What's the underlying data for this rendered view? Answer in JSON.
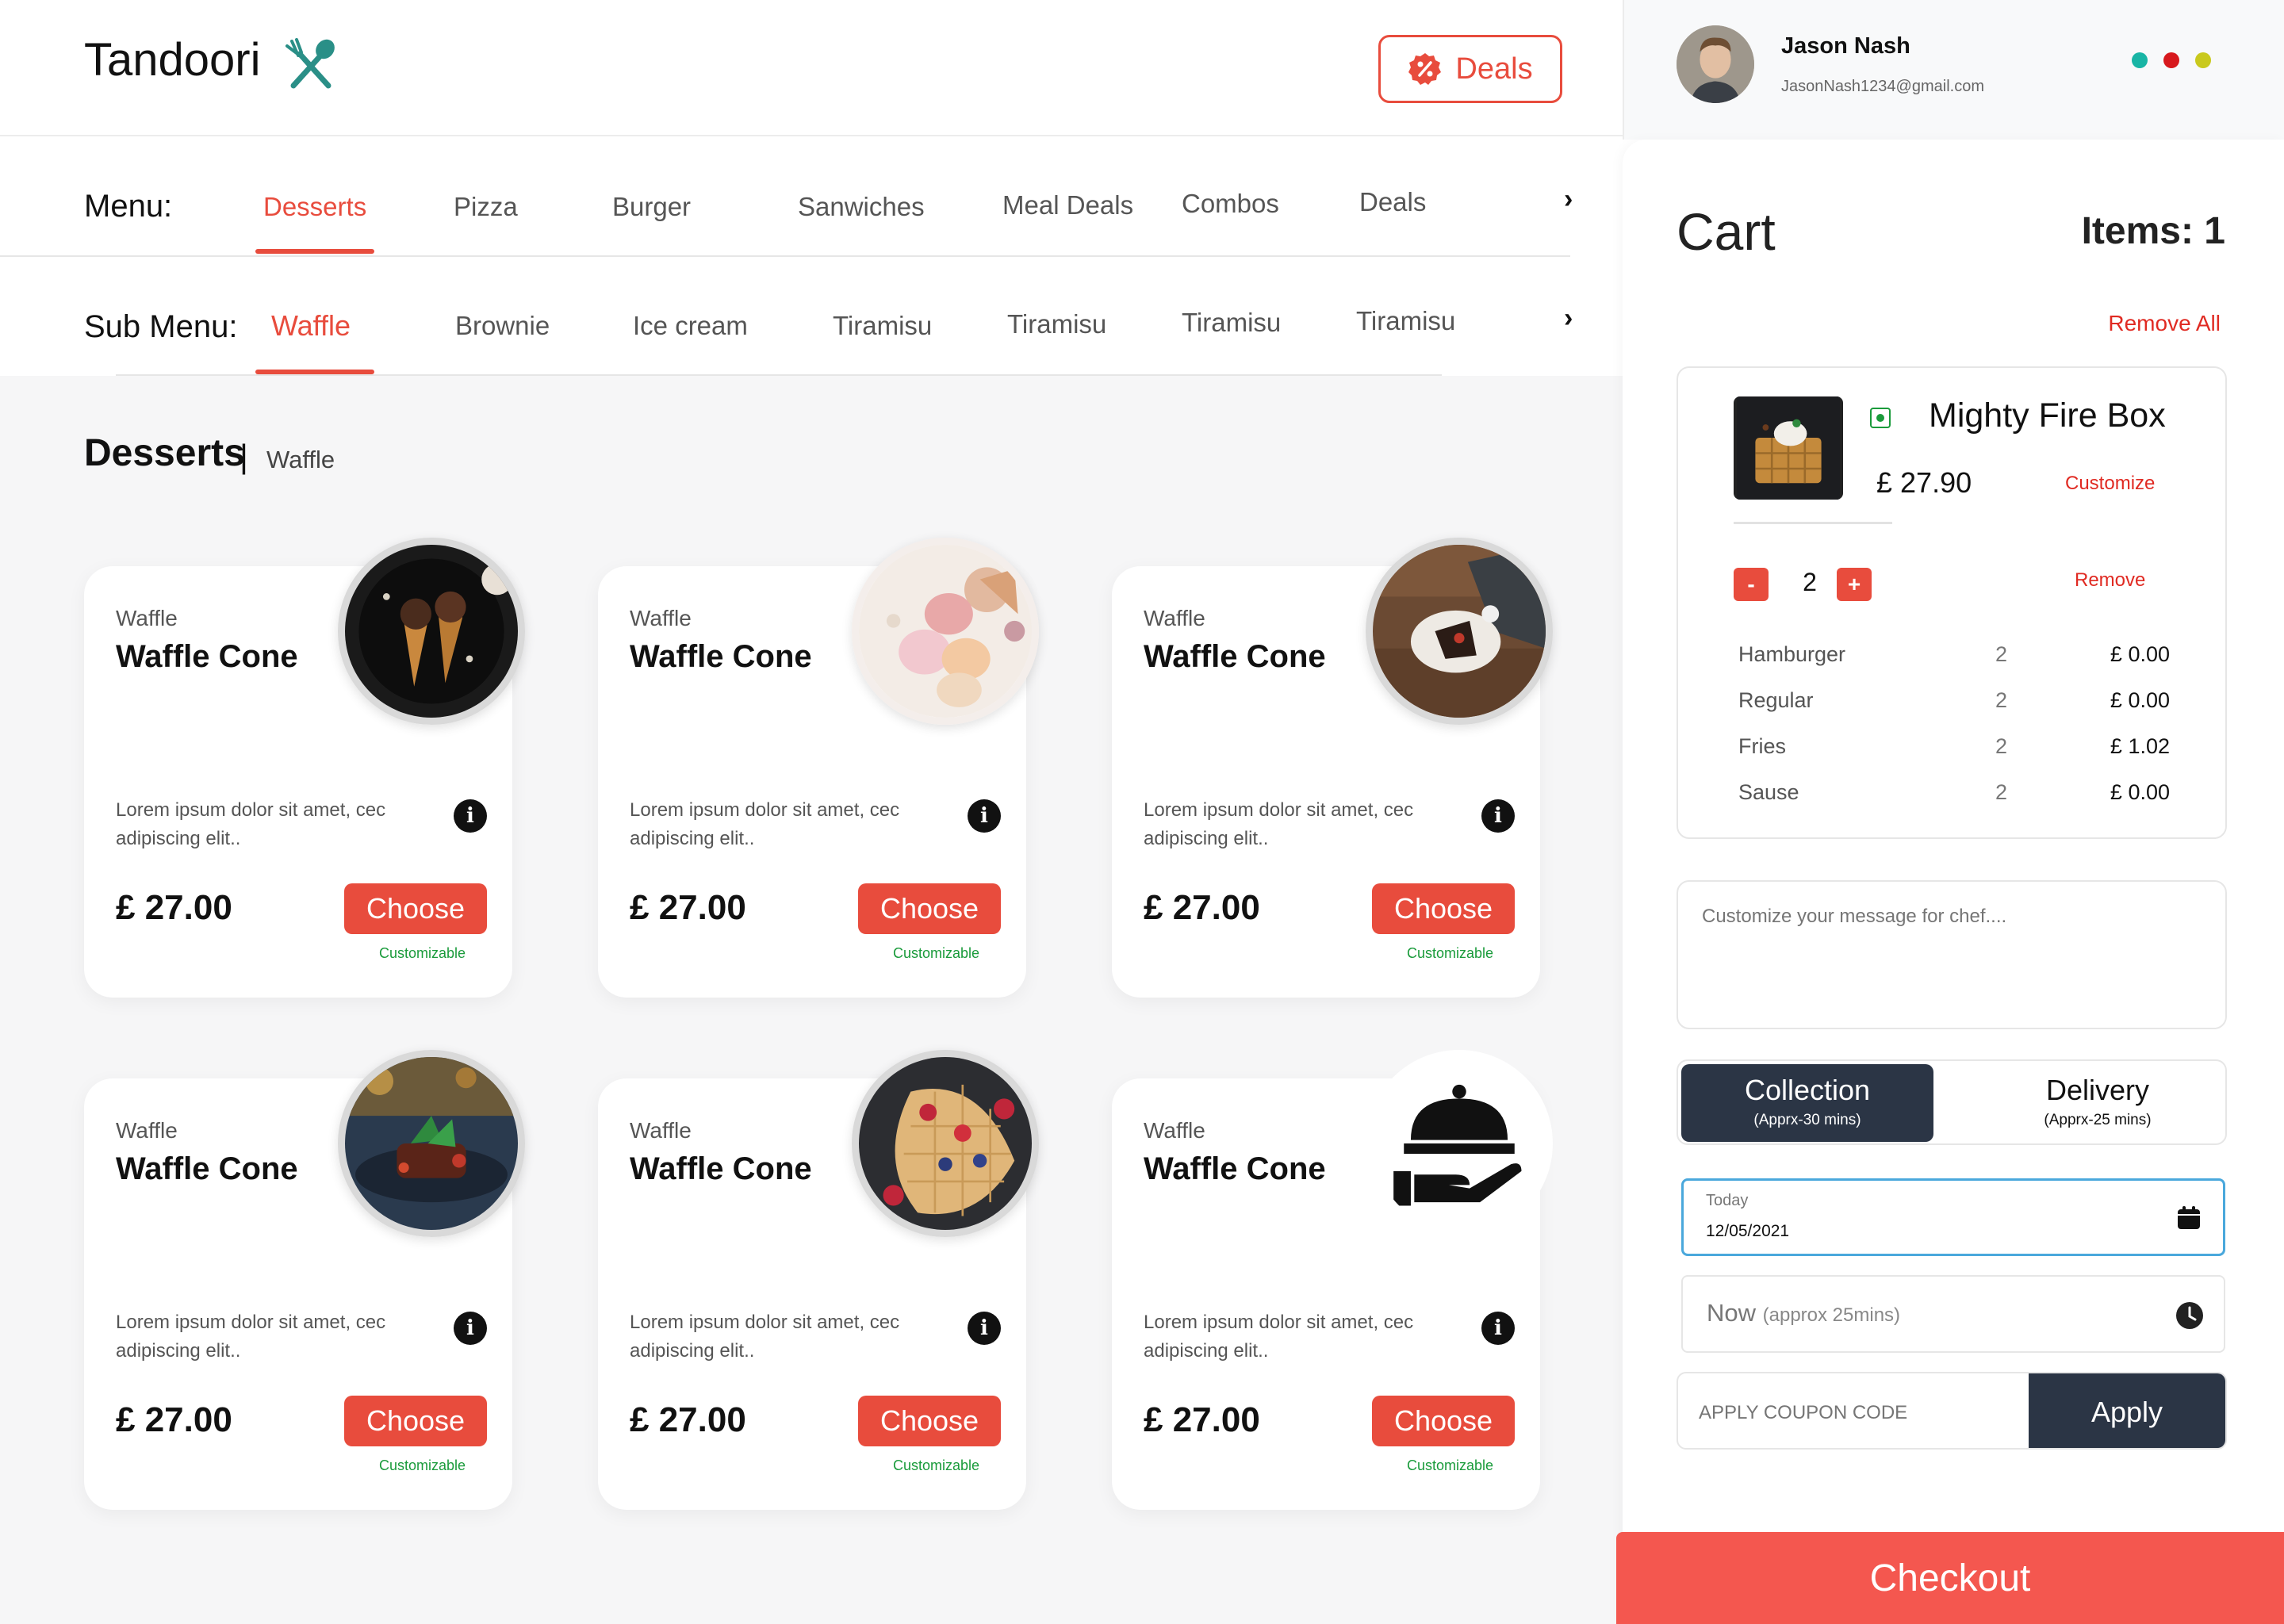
{
  "header": {
    "brand": "Tandoori",
    "deals_label": "Deals"
  },
  "menu": {
    "label": "Menu:",
    "items": [
      "Desserts",
      "Pizza",
      "Burger",
      "Sanwiches",
      "Meal Deals",
      "Combos",
      "Deals"
    ],
    "active": "Desserts"
  },
  "submenu": {
    "label": "Sub Menu:",
    "items": [
      "Waffle",
      "Brownie",
      "Ice cream",
      "Tiramisu",
      "Tiramisu",
      "Tiramisu",
      "Tiramisu"
    ],
    "active": "Waffle"
  },
  "section": {
    "title": "Desserts",
    "separator": "|",
    "subtitle": "Waffle"
  },
  "products": [
    {
      "category": "Waffle",
      "name": "Waffle Cone",
      "description": "Lorem ipsum dolor sit amet, cec adipiscing elit..",
      "price": "£ 27.00",
      "button": "Choose",
      "tag": "Customizable",
      "image": "ice-cream-cones-photo"
    },
    {
      "category": "Waffle",
      "name": "Waffle Cone",
      "description": "Lorem ipsum dolor sit amet, cec adipiscing elit..",
      "price": "£ 27.00",
      "button": "Choose",
      "tag": "Customizable",
      "image": "macarons-photo"
    },
    {
      "category": "Waffle",
      "name": "Waffle Cone",
      "description": "Lorem ipsum dolor sit amet, cec adipiscing elit..",
      "price": "£ 27.00",
      "button": "Choose",
      "tag": "Customizable",
      "image": "dessert-plate-photo"
    },
    {
      "category": "Waffle",
      "name": "Waffle Cone",
      "description": "Lorem ipsum dolor sit amet, cec adipiscing elit..",
      "price": "£ 27.00",
      "button": "Choose",
      "tag": "Customizable",
      "image": "steak-dish-photo"
    },
    {
      "category": "Waffle",
      "name": "Waffle Cone",
      "description": "Lorem ipsum dolor sit amet, cec adipiscing elit..",
      "price": "£ 27.00",
      "button": "Choose",
      "tag": "Customizable",
      "image": "berry-waffle-photo"
    },
    {
      "category": "Waffle",
      "name": "Waffle Cone",
      "description": "Lorem ipsum dolor sit amet, cec adipiscing elit..",
      "price": "£ 27.00",
      "button": "Choose",
      "tag": "Customizable",
      "image": "serving-cloche-icon"
    }
  ],
  "user": {
    "name": "Jason Nash",
    "email": "JasonNash1234@gmail.com",
    "dot_colors": [
      "#19b5a5",
      "#d7191d",
      "#c9c91d"
    ]
  },
  "cart": {
    "title": "Cart",
    "items_count": "Items: 1",
    "remove_all": "Remove All",
    "item": {
      "name": "Mighty Fire Box",
      "price": "£ 27.90",
      "customize": "Customize",
      "quantity": "2",
      "minus": "-",
      "plus": "+",
      "remove": "Remove",
      "addons": [
        {
          "name": "Hamburger",
          "qty": "2",
          "price": "£ 0.00"
        },
        {
          "name": "Regular",
          "qty": "2",
          "price": "£ 0.00"
        },
        {
          "name": "Fries",
          "qty": "2",
          "price": "£ 1.02"
        },
        {
          "name": "Sause",
          "qty": "2",
          "price": "£ 0.00"
        }
      ]
    },
    "chef_placeholder": "Customize your message for chef....",
    "collection": {
      "title": "Collection",
      "sub": "(Apprx-30 mins)"
    },
    "delivery": {
      "title": "Delivery",
      "sub": "(Apprx-25 mins)"
    },
    "date_label": "Today",
    "date_value": "12/05/2021",
    "time_main": "Now",
    "time_sub": "(approx 25mins)",
    "coupon_placeholder": "APPLY COUPON CODE",
    "apply": "Apply",
    "checkout": "Checkout"
  },
  "colors": {
    "accent": "#e84c3d",
    "dark": "#2b3545",
    "teal": "#2a8f87",
    "green": "#1a9b3b"
  }
}
